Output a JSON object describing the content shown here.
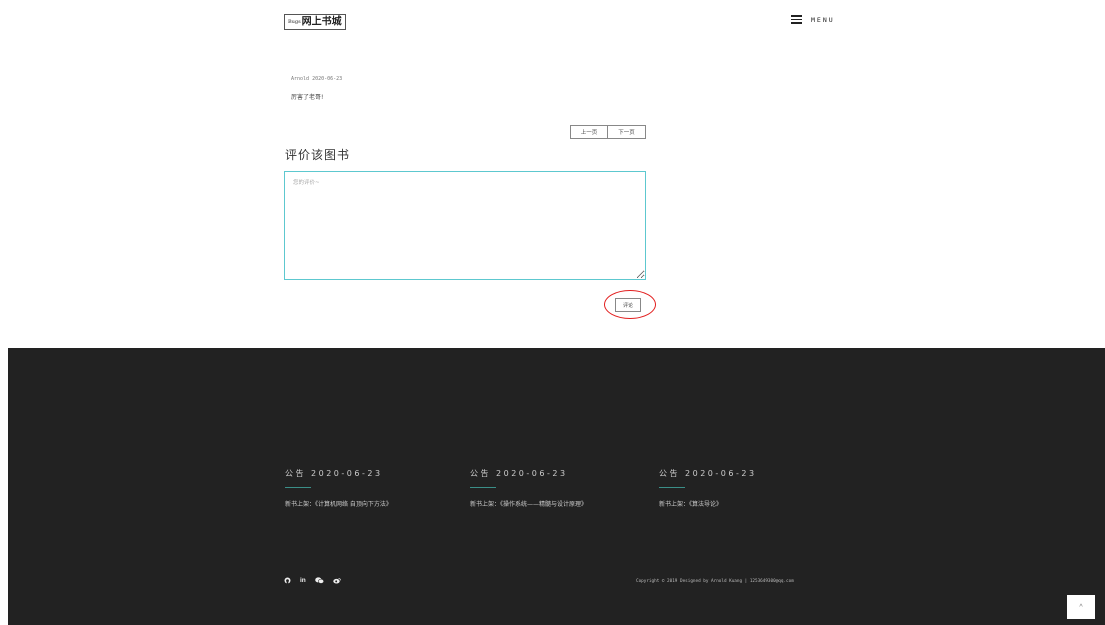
{
  "header": {
    "logo_small": "Bugs",
    "logo_main": "网上书城",
    "menu_label": "MENU"
  },
  "comment": {
    "author_date": "Arnold 2020-06-23",
    "text": "厉害了老哥!"
  },
  "pager": {
    "prev": "上一页",
    "next": "下一页"
  },
  "review": {
    "title": "评价该图书",
    "placeholder": "您的评价~",
    "submit": "评论"
  },
  "footer": {
    "notices": [
      {
        "heading": "公告 2020-06-23",
        "body": "新书上架：《计算机网络 自顶向下方法》"
      },
      {
        "heading": "公告 2020-06-23",
        "body": "新书上架：《操作系统——精髓与设计原理》"
      },
      {
        "heading": "公告 2020-06-23",
        "body": "新书上架：《算法导论》"
      }
    ],
    "social_icons": [
      "github-icon",
      "linkedin-icon",
      "wechat-icon",
      "weibo-icon"
    ],
    "copyright": "Copyright © 2019 Designed by Arnold Kuang | 1253649300@qq.com"
  },
  "back_to_top": "^",
  "colors": {
    "footer_bg": "#222222",
    "accent_border": "#5dc8cf",
    "notice_rule": "#3b8f88",
    "highlight": "#e21f1f"
  }
}
